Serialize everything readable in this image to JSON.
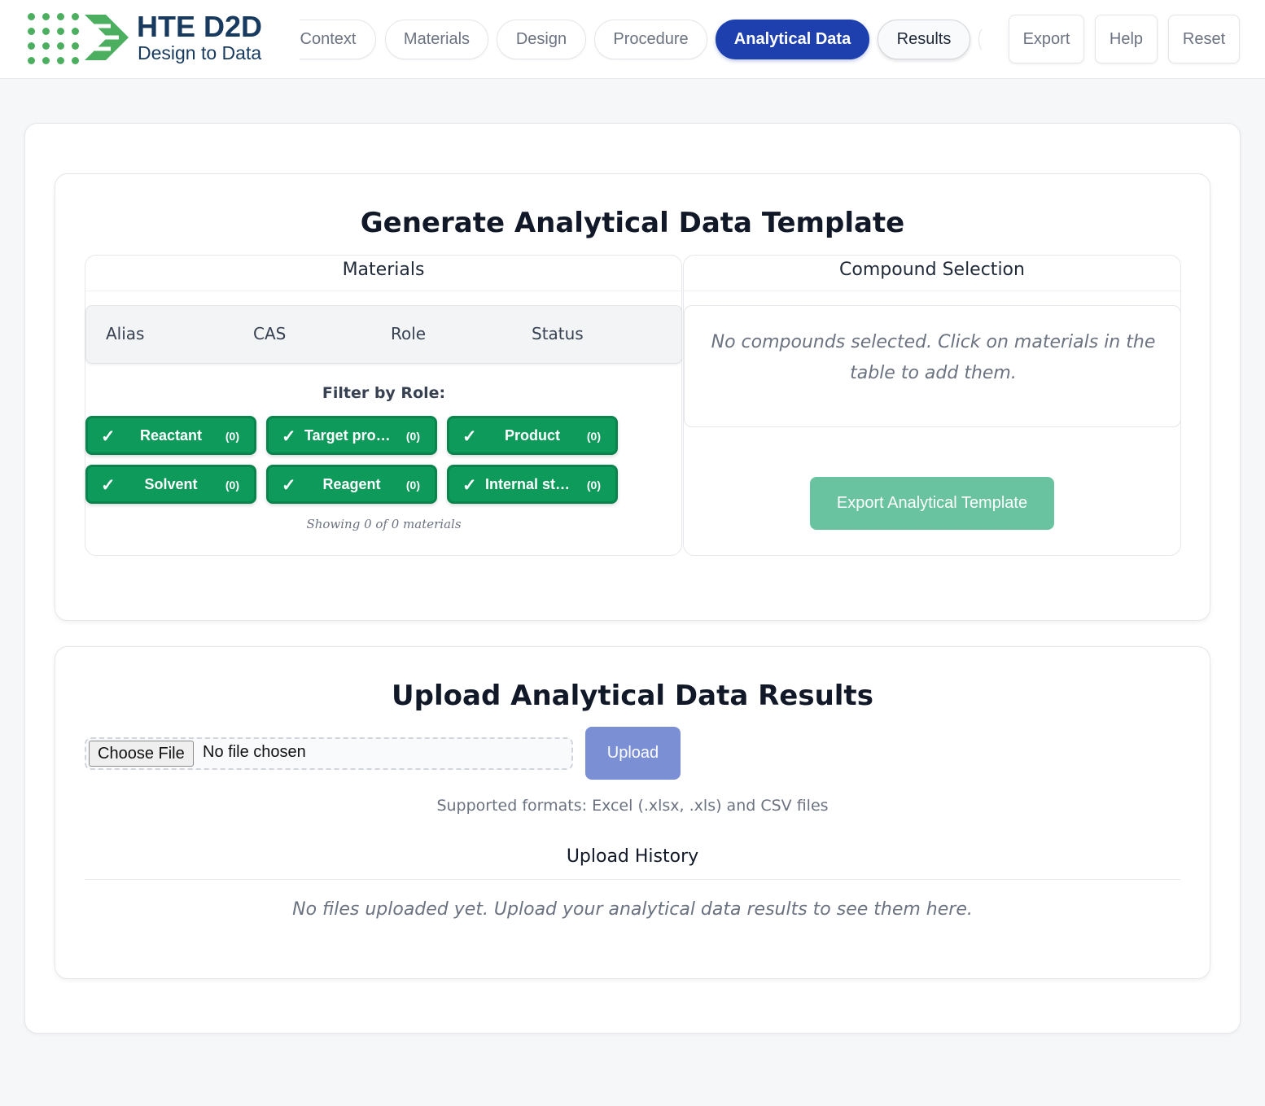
{
  "app": {
    "title": "HTE D2D",
    "subtitle": "Design to Data"
  },
  "nav": {
    "tabs": [
      {
        "label": "Context"
      },
      {
        "label": "Materials"
      },
      {
        "label": "Design"
      },
      {
        "label": "Procedure"
      },
      {
        "label": "Analytical Data"
      },
      {
        "label": "Results"
      }
    ],
    "active_tab": "Analytical Data",
    "actions": {
      "export": "Export",
      "help": "Help",
      "reset": "Reset"
    }
  },
  "template_section": {
    "title": "Generate Analytical Data Template",
    "materials": {
      "heading": "Materials",
      "columns": [
        "Alias",
        "CAS",
        "Role",
        "Status"
      ],
      "filter_label": "Filter by Role:",
      "filters": [
        {
          "label": "Reactant",
          "count": "(0)",
          "checked": true
        },
        {
          "label": "Target product",
          "count": "(0)",
          "checked": true
        },
        {
          "label": "Product",
          "count": "(0)",
          "checked": true
        },
        {
          "label": "Solvent",
          "count": "(0)",
          "checked": true
        },
        {
          "label": "Reagent",
          "count": "(0)",
          "checked": true
        },
        {
          "label": "Internal standard",
          "count": "(0)",
          "checked": true
        }
      ],
      "showing": "Showing 0 of 0 materials"
    },
    "compounds": {
      "heading": "Compound Selection",
      "empty_text": "No compounds selected. Click on materials in the table to add them.",
      "export_button": "Export Analytical Template"
    }
  },
  "upload_section": {
    "title": "Upload Analytical Data Results",
    "choose_file": "Choose File",
    "file_status": "No file chosen",
    "upload_button": "Upload",
    "formats": "Supported formats: Excel (.xlsx, .xls) and CSV files",
    "history_title": "Upload History",
    "history_empty": "No files uploaded yet. Upload your analytical data results to see them here."
  },
  "colors": {
    "primary": "#1e40af",
    "chip_green": "#0e9a5b",
    "export_green": "#6ac3a0",
    "upload_blue": "#7b8fd4",
    "logo_navy": "#173a5e",
    "logo_green": "#4caf5f"
  },
  "icons": [
    "logo-dots-icon",
    "logo-arrow-icon",
    "check-icon"
  ]
}
